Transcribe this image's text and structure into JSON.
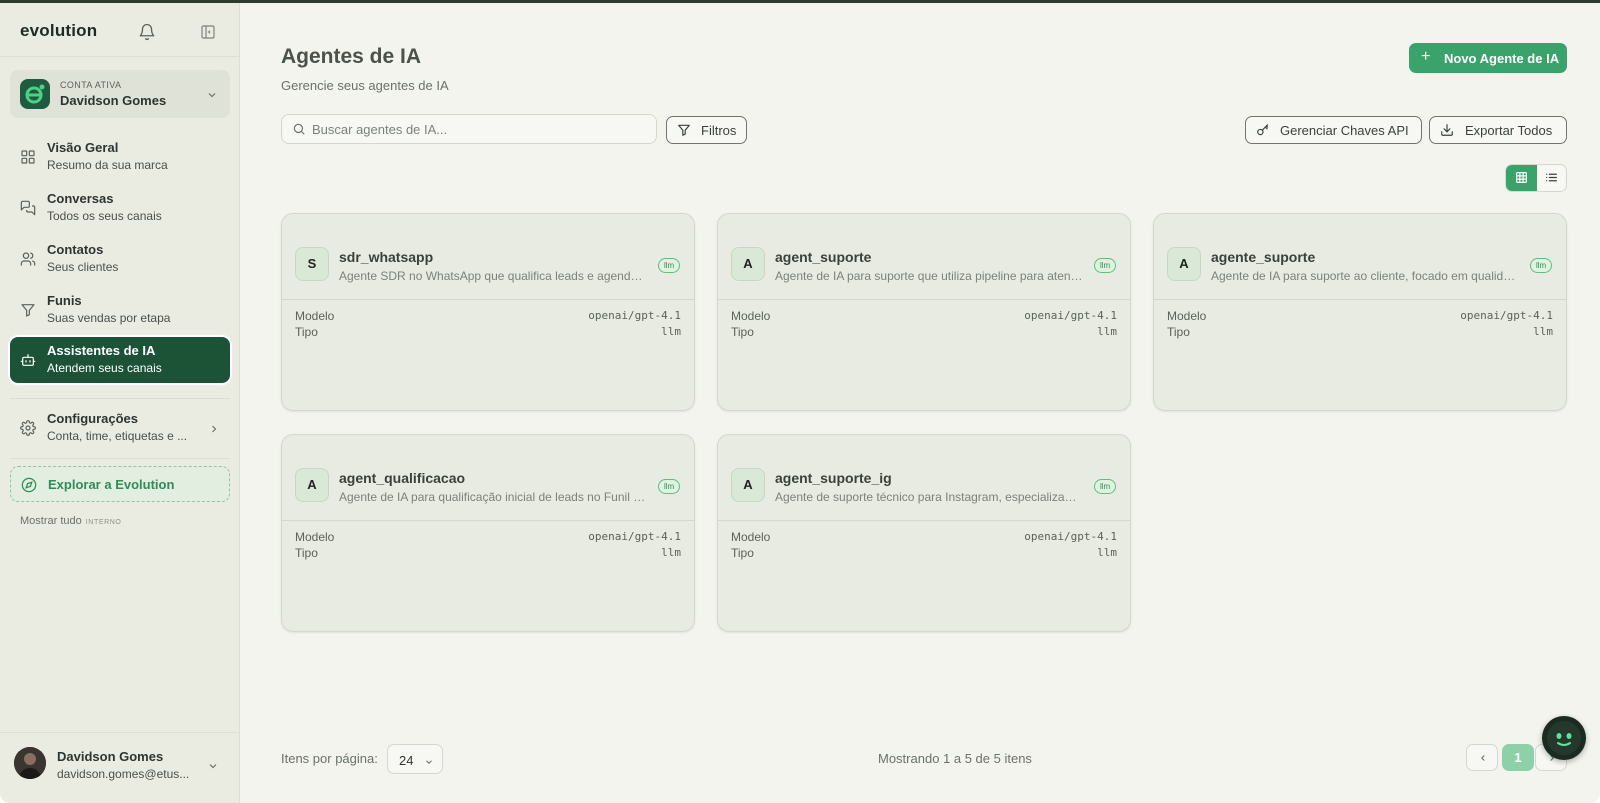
{
  "app": {
    "logo": "evolution"
  },
  "sidebar": {
    "account": {
      "label": "CONTA ATIVA",
      "name": "Davidson Gomes"
    },
    "items": [
      {
        "title": "Visão Geral",
        "subtitle": "Resumo da sua marca",
        "icon": "grid-icon"
      },
      {
        "title": "Conversas",
        "subtitle": "Todos os seus canais",
        "icon": "chat-icon"
      },
      {
        "title": "Contatos",
        "subtitle": "Seus clientes",
        "icon": "users-icon"
      },
      {
        "title": "Funis",
        "subtitle": "Suas vendas por etapa",
        "icon": "funnel-icon"
      },
      {
        "title": "Assistentes de IA",
        "subtitle": "Atendem seus canais",
        "icon": "bot-icon",
        "active": true
      },
      {
        "title": "Configurações",
        "subtitle": "Conta, time, etiquetas e ...",
        "icon": "gear-icon"
      }
    ],
    "explore": "Explorar a Evolution",
    "show_all": "Mostrar tudo",
    "show_all_tag": "INTERNO",
    "user": {
      "name": "Davidson Gomes",
      "email": "davidson.gomes@etus..."
    }
  },
  "main": {
    "title": "Agentes de IA",
    "subtitle": "Gerencie seus agentes de IA",
    "new_button": "Novo Agente de IA",
    "search_placeholder": "Buscar agentes de IA...",
    "filters_button": "Filtros",
    "api_keys_button": "Gerenciar Chaves API",
    "export_button": "Exportar Todos",
    "field_labels": {
      "model": "Modelo",
      "type": "Tipo"
    },
    "agents": [
      {
        "initial": "S",
        "name": "sdr_whatsapp",
        "description": "Agente SDR no WhatsApp que qualifica leads e agenda reuniões",
        "badge": "llm",
        "model": "openai/gpt-4.1",
        "type": "llm"
      },
      {
        "initial": "A",
        "name": "agent_suporte",
        "description": "Agente de IA para suporte que utiliza pipeline para atendimento",
        "badge": "llm",
        "model": "openai/gpt-4.1",
        "type": "llm"
      },
      {
        "initial": "A",
        "name": "agente_suporte",
        "description": "Agente de IA para suporte ao cliente, focado em qualidade",
        "badge": "llm",
        "model": "openai/gpt-4.1",
        "type": "llm"
      },
      {
        "initial": "A",
        "name": "agent_qualificacao",
        "description": "Agente de IA para qualificação inicial de leads no Funil de vendas",
        "badge": "llm",
        "model": "openai/gpt-4.1",
        "type": "llm"
      },
      {
        "initial": "A",
        "name": "agent_suporte_ig",
        "description": "Agente de suporte técnico para Instagram, especializado em clientes",
        "badge": "llm",
        "model": "openai/gpt-4.1",
        "type": "llm"
      }
    ],
    "pagination": {
      "per_page_label": "Itens por página:",
      "per_page_value": "24",
      "showing": "Mostrando 1 a 5 de 5 itens",
      "current_page": "1"
    }
  },
  "colors": {
    "accent": "#3aa36b",
    "sidebar_active": "#1c5336",
    "background": "#f3f4ee"
  }
}
